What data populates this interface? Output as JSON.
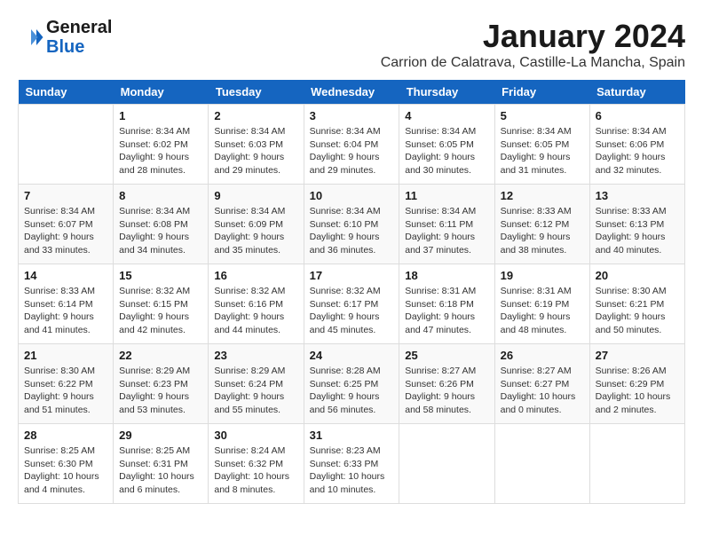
{
  "header": {
    "logo_line1": "General",
    "logo_line2": "Blue",
    "month": "January 2024",
    "location": "Carrion de Calatrava, Castille-La Mancha, Spain"
  },
  "days_of_week": [
    "Sunday",
    "Monday",
    "Tuesday",
    "Wednesday",
    "Thursday",
    "Friday",
    "Saturday"
  ],
  "weeks": [
    [
      {
        "day": "",
        "info": ""
      },
      {
        "day": "1",
        "info": "Sunrise: 8:34 AM\nSunset: 6:02 PM\nDaylight: 9 hours\nand 28 minutes."
      },
      {
        "day": "2",
        "info": "Sunrise: 8:34 AM\nSunset: 6:03 PM\nDaylight: 9 hours\nand 29 minutes."
      },
      {
        "day": "3",
        "info": "Sunrise: 8:34 AM\nSunset: 6:04 PM\nDaylight: 9 hours\nand 29 minutes."
      },
      {
        "day": "4",
        "info": "Sunrise: 8:34 AM\nSunset: 6:05 PM\nDaylight: 9 hours\nand 30 minutes."
      },
      {
        "day": "5",
        "info": "Sunrise: 8:34 AM\nSunset: 6:05 PM\nDaylight: 9 hours\nand 31 minutes."
      },
      {
        "day": "6",
        "info": "Sunrise: 8:34 AM\nSunset: 6:06 PM\nDaylight: 9 hours\nand 32 minutes."
      }
    ],
    [
      {
        "day": "7",
        "info": "Sunrise: 8:34 AM\nSunset: 6:07 PM\nDaylight: 9 hours\nand 33 minutes."
      },
      {
        "day": "8",
        "info": "Sunrise: 8:34 AM\nSunset: 6:08 PM\nDaylight: 9 hours\nand 34 minutes."
      },
      {
        "day": "9",
        "info": "Sunrise: 8:34 AM\nSunset: 6:09 PM\nDaylight: 9 hours\nand 35 minutes."
      },
      {
        "day": "10",
        "info": "Sunrise: 8:34 AM\nSunset: 6:10 PM\nDaylight: 9 hours\nand 36 minutes."
      },
      {
        "day": "11",
        "info": "Sunrise: 8:34 AM\nSunset: 6:11 PM\nDaylight: 9 hours\nand 37 minutes."
      },
      {
        "day": "12",
        "info": "Sunrise: 8:33 AM\nSunset: 6:12 PM\nDaylight: 9 hours\nand 38 minutes."
      },
      {
        "day": "13",
        "info": "Sunrise: 8:33 AM\nSunset: 6:13 PM\nDaylight: 9 hours\nand 40 minutes."
      }
    ],
    [
      {
        "day": "14",
        "info": "Sunrise: 8:33 AM\nSunset: 6:14 PM\nDaylight: 9 hours\nand 41 minutes."
      },
      {
        "day": "15",
        "info": "Sunrise: 8:32 AM\nSunset: 6:15 PM\nDaylight: 9 hours\nand 42 minutes."
      },
      {
        "day": "16",
        "info": "Sunrise: 8:32 AM\nSunset: 6:16 PM\nDaylight: 9 hours\nand 44 minutes."
      },
      {
        "day": "17",
        "info": "Sunrise: 8:32 AM\nSunset: 6:17 PM\nDaylight: 9 hours\nand 45 minutes."
      },
      {
        "day": "18",
        "info": "Sunrise: 8:31 AM\nSunset: 6:18 PM\nDaylight: 9 hours\nand 47 minutes."
      },
      {
        "day": "19",
        "info": "Sunrise: 8:31 AM\nSunset: 6:19 PM\nDaylight: 9 hours\nand 48 minutes."
      },
      {
        "day": "20",
        "info": "Sunrise: 8:30 AM\nSunset: 6:21 PM\nDaylight: 9 hours\nand 50 minutes."
      }
    ],
    [
      {
        "day": "21",
        "info": "Sunrise: 8:30 AM\nSunset: 6:22 PM\nDaylight: 9 hours\nand 51 minutes."
      },
      {
        "day": "22",
        "info": "Sunrise: 8:29 AM\nSunset: 6:23 PM\nDaylight: 9 hours\nand 53 minutes."
      },
      {
        "day": "23",
        "info": "Sunrise: 8:29 AM\nSunset: 6:24 PM\nDaylight: 9 hours\nand 55 minutes."
      },
      {
        "day": "24",
        "info": "Sunrise: 8:28 AM\nSunset: 6:25 PM\nDaylight: 9 hours\nand 56 minutes."
      },
      {
        "day": "25",
        "info": "Sunrise: 8:27 AM\nSunset: 6:26 PM\nDaylight: 9 hours\nand 58 minutes."
      },
      {
        "day": "26",
        "info": "Sunrise: 8:27 AM\nSunset: 6:27 PM\nDaylight: 10 hours\nand 0 minutes."
      },
      {
        "day": "27",
        "info": "Sunrise: 8:26 AM\nSunset: 6:29 PM\nDaylight: 10 hours\nand 2 minutes."
      }
    ],
    [
      {
        "day": "28",
        "info": "Sunrise: 8:25 AM\nSunset: 6:30 PM\nDaylight: 10 hours\nand 4 minutes."
      },
      {
        "day": "29",
        "info": "Sunrise: 8:25 AM\nSunset: 6:31 PM\nDaylight: 10 hours\nand 6 minutes."
      },
      {
        "day": "30",
        "info": "Sunrise: 8:24 AM\nSunset: 6:32 PM\nDaylight: 10 hours\nand 8 minutes."
      },
      {
        "day": "31",
        "info": "Sunrise: 8:23 AM\nSunset: 6:33 PM\nDaylight: 10 hours\nand 10 minutes."
      },
      {
        "day": "",
        "info": ""
      },
      {
        "day": "",
        "info": ""
      },
      {
        "day": "",
        "info": ""
      }
    ]
  ]
}
